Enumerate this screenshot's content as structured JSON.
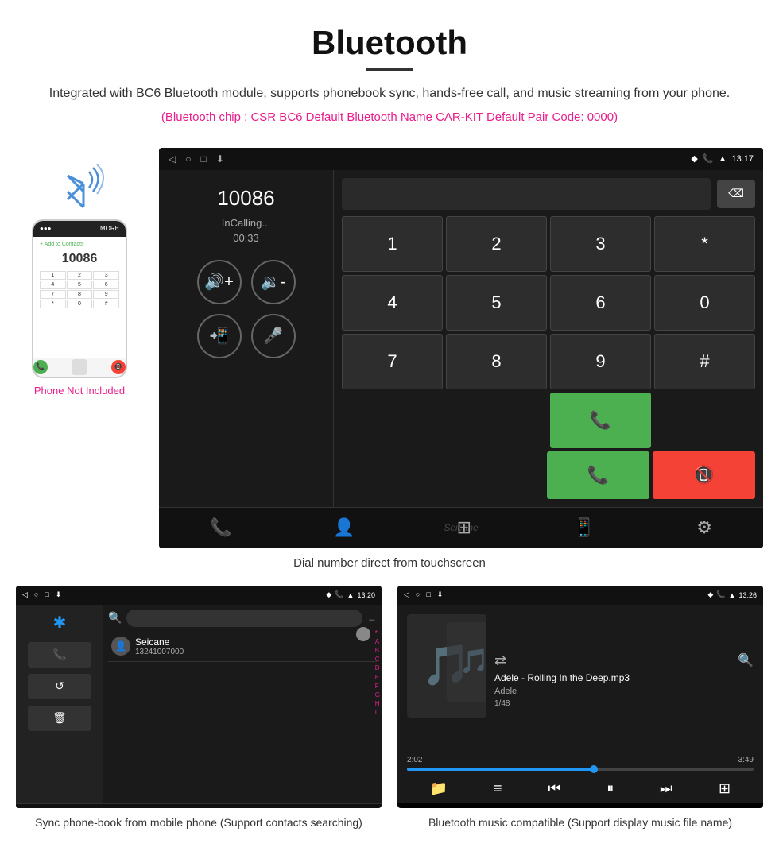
{
  "page": {
    "title": "Bluetooth",
    "description": "Integrated with BC6 Bluetooth module, supports phonebook sync, hands-free call, and music streaming from your phone.",
    "specs": "(Bluetooth chip : CSR BC6    Default Bluetooth Name CAR-KIT    Default Pair Code: 0000)",
    "phone_label": "Phone Not Included",
    "caption_main": "Dial number direct from touchscreen",
    "caption_phonebook": "Sync phone-book from mobile phone\n(Support contacts searching)",
    "caption_music": "Bluetooth music compatible\n(Support display music file name)"
  },
  "status_bar": {
    "nav_back": "◁",
    "nav_home": "○",
    "nav_square": "□",
    "nav_download": "⤓",
    "time": "13:17",
    "location": "♦",
    "phone": "📞",
    "signal": "▲"
  },
  "status_bar2": {
    "time": "13:20"
  },
  "status_bar3": {
    "time": "13:26"
  },
  "call": {
    "number": "10086",
    "status": "InCalling...",
    "timer": "00:33",
    "vol_up": "🔊",
    "vol_down": "🔉",
    "phone_icon": "📱",
    "mic_icon": "🎤"
  },
  "numpad": {
    "keys": [
      "1",
      "2",
      "3",
      "*",
      "4",
      "5",
      "6",
      "0",
      "7",
      "8",
      "9",
      "#"
    ],
    "call": "📞",
    "end": "📵",
    "delete": "⌫"
  },
  "bottom_nav": {
    "icons": [
      "📞",
      "👤",
      "⊞",
      "📱",
      "⚙"
    ]
  },
  "phonebook": {
    "contact_name": "Seicane",
    "contact_number": "13241007000",
    "letters": [
      "*",
      "A",
      "B",
      "C",
      "D",
      "E",
      "F",
      "G",
      "H",
      "I"
    ],
    "bt_icon": "✱",
    "search_icon": "🔍",
    "back_icon": "←"
  },
  "music": {
    "title": "Adele - Rolling In the Deep.mp3",
    "artist": "Adele",
    "track": "1/48",
    "current_time": "2:02",
    "total_time": "3:49",
    "progress_pct": 54,
    "shuffle": "⇄",
    "search": "🔍",
    "prev": "⏮",
    "play": "⏸",
    "next": "⏭",
    "folder": "📁",
    "list": "≡",
    "eq": "⊞"
  },
  "watermark": "Seicane"
}
